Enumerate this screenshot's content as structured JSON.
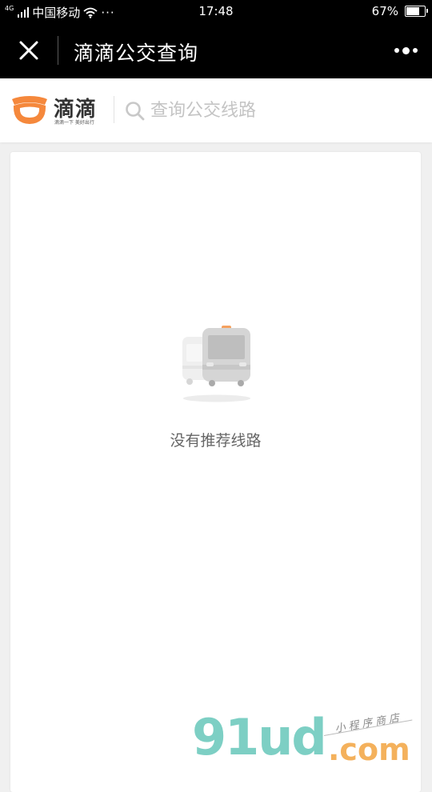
{
  "status_bar": {
    "network_type": "4G",
    "carrier": "中国移动",
    "more_indicator": "···",
    "time": "17:48",
    "battery_text": "67%",
    "battery_level": 0.67
  },
  "title_bar": {
    "title": "滴滴公交查询"
  },
  "header": {
    "brand_name": "滴滴",
    "brand_slogan": "滴滴一下 美好出行",
    "brand_color": "#f5883c",
    "search_placeholder": "查询公交线路"
  },
  "empty_state": {
    "message": "没有推荐线路",
    "icon": "bus-icon"
  },
  "watermark": {
    "main_text": "91ud",
    "domain_text": ".com",
    "sub_text": "小程序商店"
  },
  "colors": {
    "status_bar_bg": "#000000",
    "page_bg": "#f0f0f0",
    "accent_orange": "#f5883c",
    "placeholder_gray": "#c4c4c4",
    "watermark_teal": "#7dcfc4",
    "watermark_orange": "#f4b15c"
  }
}
